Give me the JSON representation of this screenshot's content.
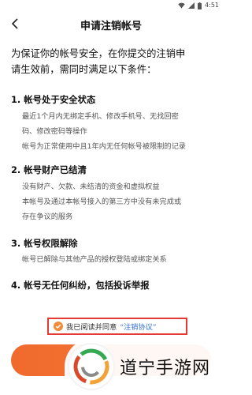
{
  "status": {
    "time": "4:51"
  },
  "nav": {
    "title": "申请注销帐号"
  },
  "intro": {
    "line1": "为保证你的帐号安全，在你提交的注销申",
    "line2": "请生效前，需同时满足以下条件："
  },
  "sections": [
    {
      "title": "1. 帐号处于安全状态",
      "lines": [
        "最近1个月内无绑定手机、修改手机号、无找回密",
        "码、修改密码等操作",
        "帐号为正常使用中且1年内无任何帐号被限制的记录"
      ]
    },
    {
      "title": "2. 帐号财产已结清",
      "lines": [
        "没有财产、欠款、未结清的资金和虚拟权益",
        "本帐号及通过本帐号接入的第三方中没有未完成或",
        "存在争议的服务"
      ]
    },
    {
      "title": "3. 帐号权限解除",
      "lines": [
        "帐号已解除与其他产品的授权登陆或绑定关系"
      ]
    },
    {
      "title": "4. 帐号无任何纠纷，包括投诉举报",
      "lines": []
    }
  ],
  "agreement": {
    "prefix": "我已阅读并同意",
    "link": "“注销协议”",
    "checked": true
  },
  "watermark": {
    "text": "道宁手游网"
  },
  "colors": {
    "accent": "#f06a2c",
    "link": "#2f6fd6",
    "highlight_border": "#e53935"
  }
}
